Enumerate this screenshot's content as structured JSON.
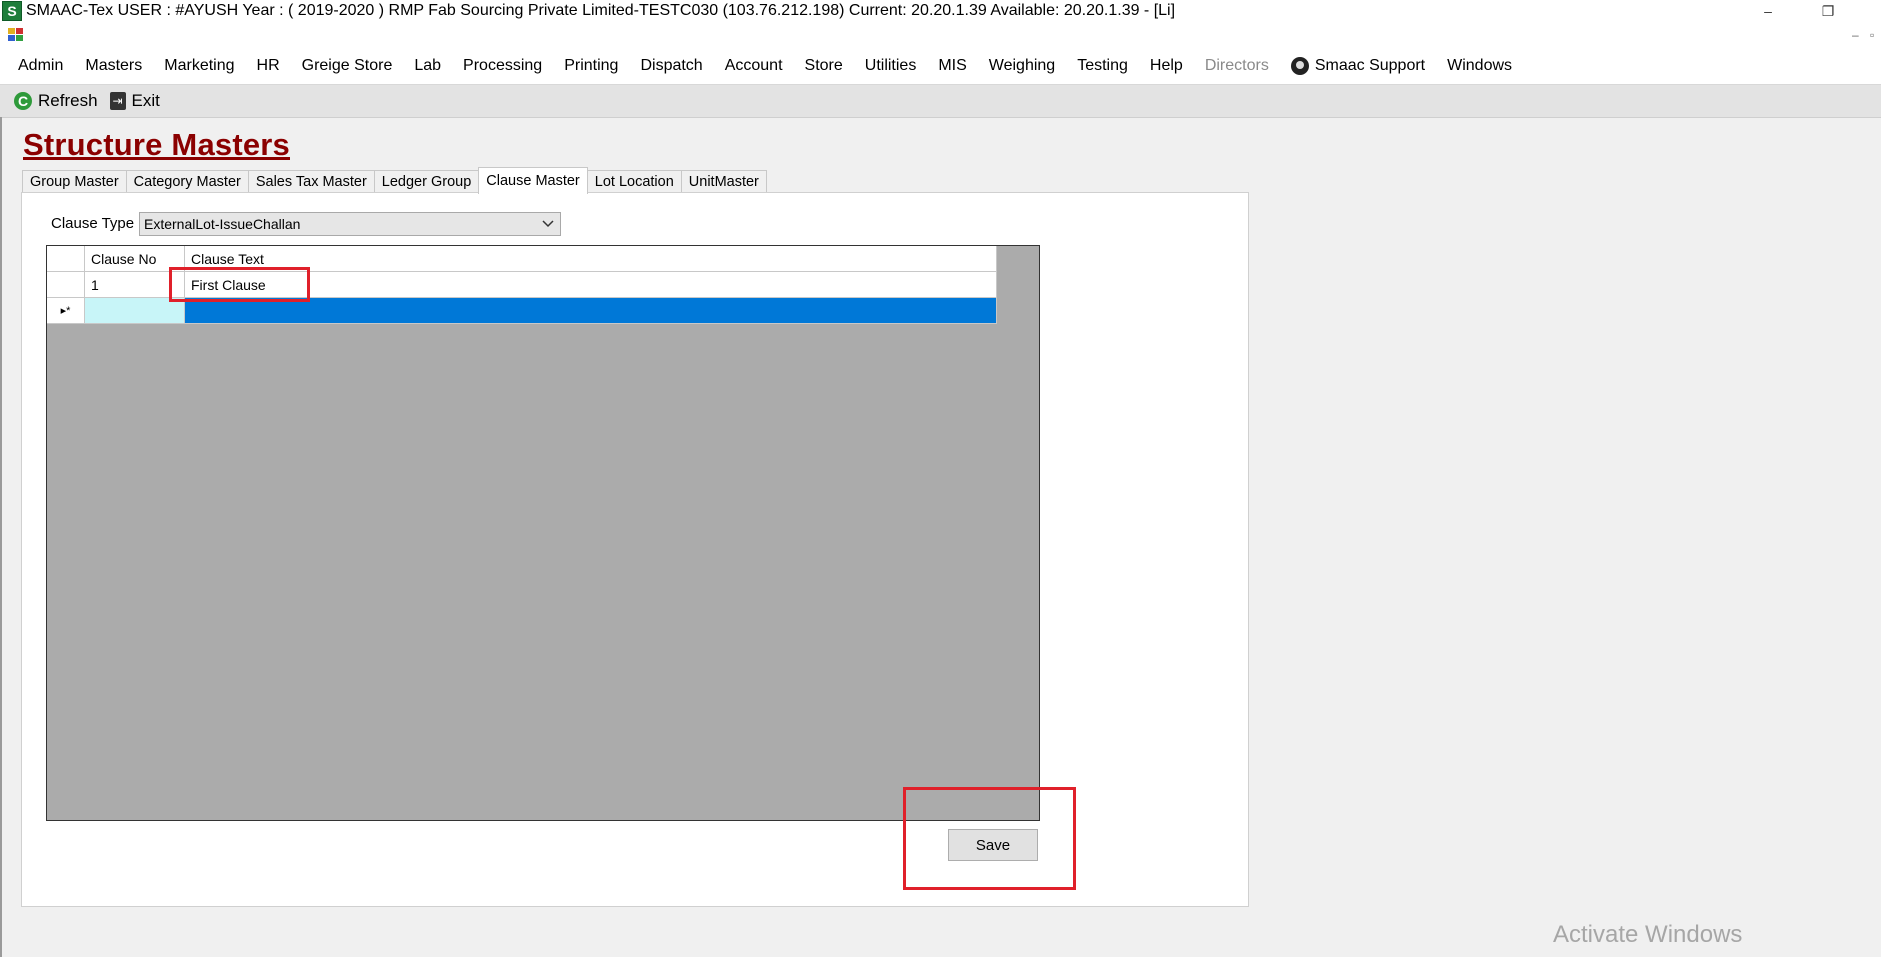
{
  "window": {
    "title": "SMAAC-Tex  USER : #AYUSH  Year : ( 2019-2020 )   RMP Fab Sourcing Private Limited-TESTC030 (103.76.212.198)  Current: 20.20.1.39  Available: 20.20.1.39  - [Li]",
    "app_icon_letter": "S",
    "minimize_glyph": "–",
    "restore_glyph": "❐"
  },
  "mdi": {
    "minimize_glyph": "–",
    "restore_glyph": "▫"
  },
  "menu": {
    "items": [
      "Admin",
      "Masters",
      "Marketing",
      "HR",
      "Greige Store",
      "Lab",
      "Processing",
      "Printing",
      "Dispatch",
      "Account",
      "Store",
      "Utilities",
      "MIS",
      "Weighing",
      "Testing",
      "Help"
    ],
    "directors": "Directors",
    "support": "Smaac Support",
    "windows": "Windows"
  },
  "toolbar": {
    "refresh_icon": "C",
    "refresh": "Refresh",
    "exit_icon": "⇥",
    "exit": "Exit"
  },
  "page": {
    "title": "Structure Masters"
  },
  "tabs": [
    "Group Master",
    "Category Master",
    "Sales Tax Master",
    "Ledger Group",
    "Clause Master",
    "Lot Location",
    "UnitMaster"
  ],
  "active_tab": "Clause Master",
  "form": {
    "clause_type_label": "Clause Type",
    "clause_type_value": "ExternalLot-IssueChallan"
  },
  "grid": {
    "columns": [
      "Clause No",
      "Clause Text"
    ],
    "rows": [
      {
        "no": "1",
        "text": "First Clause"
      }
    ],
    "new_row_marker": "▸*"
  },
  "save_label": "Save",
  "watermark": "Activate Windows",
  "colors": {
    "title": "#8b0000",
    "highlight": "#e0202a",
    "selection": "#0078d7",
    "grid_background": "#ababab"
  }
}
